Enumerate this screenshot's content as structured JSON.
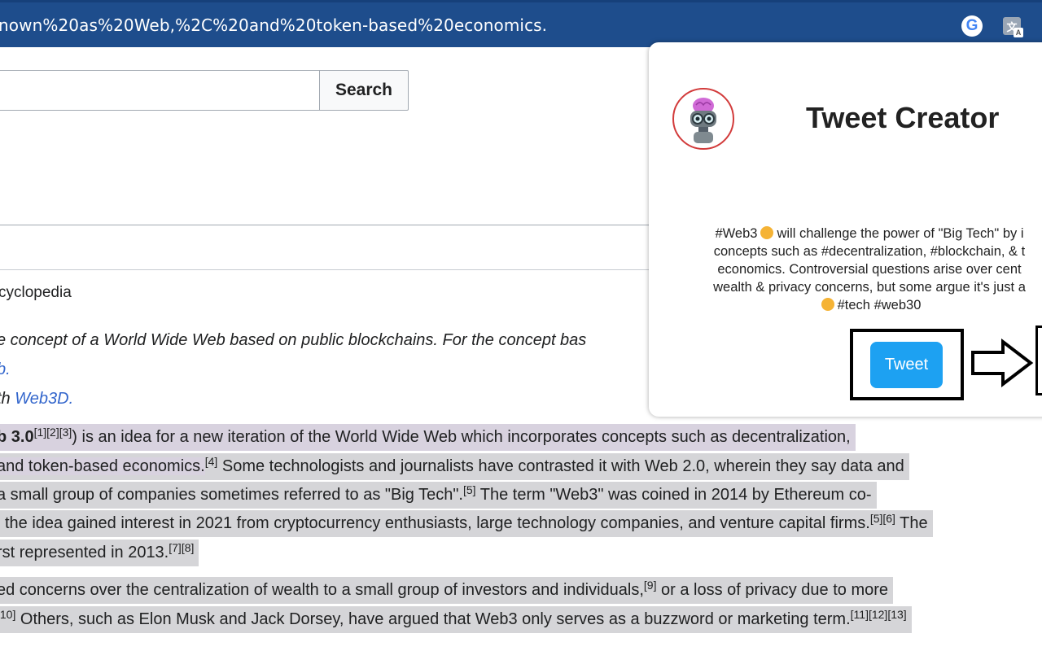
{
  "browser": {
    "url_text": "nown%20as%20Web,%2C%20and%20token-based%20economics.",
    "icons": [
      "google-icon",
      "translate-icon"
    ]
  },
  "wiki": {
    "search_button": "Search",
    "subtitle": "cyclopedia",
    "hatnotes": [
      {
        "text": "e concept of a World Wide Web based on public blockchains. For the concept bas"
      },
      {
        "link": "b."
      },
      {
        "prefix": "th ",
        "link": "Web3D."
      }
    ],
    "paragraph1": [
      {
        "bold": "b 3.0",
        "sup": "[1][2][3]",
        "text": ") is an idea for a new iteration of the World Wide Web which incorporates concepts such as decentralization,"
      },
      {
        "text": "and token-based economics.",
        "sup": "[4]",
        "text2": " Some technologists and journalists have contrasted it with Web 2.0, wherein they say data and"
      },
      {
        "text": " a small group of companies sometimes referred to as \"Big Tech\".",
        "sup": "[5]",
        "text2": " The term \"Web3\" was coined in 2014 by Ethereum co-"
      },
      {
        "text": "l the idea gained interest in 2021 from cryptocurrency enthusiasts, large technology companies, and venture capital firms.",
        "sup": "[5][6]",
        "text2": " The"
      },
      {
        "text": "rst represented in 2013.",
        "sup": "[7][8]"
      }
    ],
    "paragraph2": [
      {
        "text": "ed concerns over the centralization of wealth to a small group of investors and individuals,",
        "sup": "[9]",
        "text2": " or a loss of privacy due to more"
      },
      {
        "sup0": "[10]",
        "text": " Others, such as Elon Musk and Jack Dorsey, have argued that Web3 only serves as a buzzword or marketing term.",
        "sup": "[11][12][13]"
      }
    ]
  },
  "popup": {
    "title": "Tweet Creator",
    "tweet_lines": [
      {
        "pre": "#Web3",
        "post": "will challenge the power of \"Big Tech\" by i"
      },
      {
        "text": "concepts such as #decentralization, #blockchain, & t"
      },
      {
        "text": "economics. Controversial questions arise over cent"
      },
      {
        "text": "wealth & privacy concerns, but some argue it's just a"
      },
      {
        "text": "#tech #web30"
      }
    ],
    "tweet_button": "Tweet",
    "colors": {
      "tweet_button": "#1da1f2",
      "avatar_ring": "#d23b3b"
    }
  }
}
